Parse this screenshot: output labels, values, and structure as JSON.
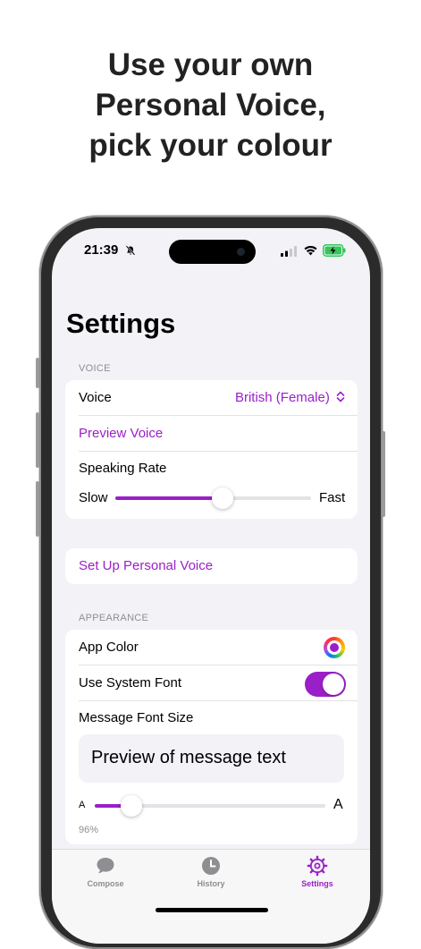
{
  "headline": [
    "Use your own",
    "Personal Voice,",
    "pick your colour"
  ],
  "status_bar": {
    "time": "21:39"
  },
  "screen_title": "Settings",
  "voice_section": {
    "header": "VOICE",
    "voice_label": "Voice",
    "voice_value": "British (Female)",
    "preview_voice": "Preview Voice",
    "speaking_rate_label": "Speaking Rate",
    "slow_label": "Slow",
    "fast_label": "Fast",
    "speaking_rate_value": 0.55
  },
  "personal_voice_button": "Set Up Personal Voice",
  "appearance_section": {
    "header": "APPEARANCE",
    "app_color_label": "App Color",
    "app_color": "#9b1fc9",
    "system_font_label": "Use System Font",
    "system_font_on": true,
    "font_size_label": "Message Font Size",
    "preview_text": "Preview of message text",
    "small_a": "A",
    "large_a": "A",
    "font_size_percent": "96%",
    "font_size_value": 0.16
  },
  "tabs": [
    {
      "label": "Compose",
      "icon": "message-bubble-icon",
      "active": false
    },
    {
      "label": "History",
      "icon": "clock-icon",
      "active": false
    },
    {
      "label": "Settings",
      "icon": "gear-icon",
      "active": true
    }
  ],
  "colors": {
    "accent": "#9b1fc9",
    "inactive": "#8e8e93",
    "background": "#f2f2f7"
  }
}
